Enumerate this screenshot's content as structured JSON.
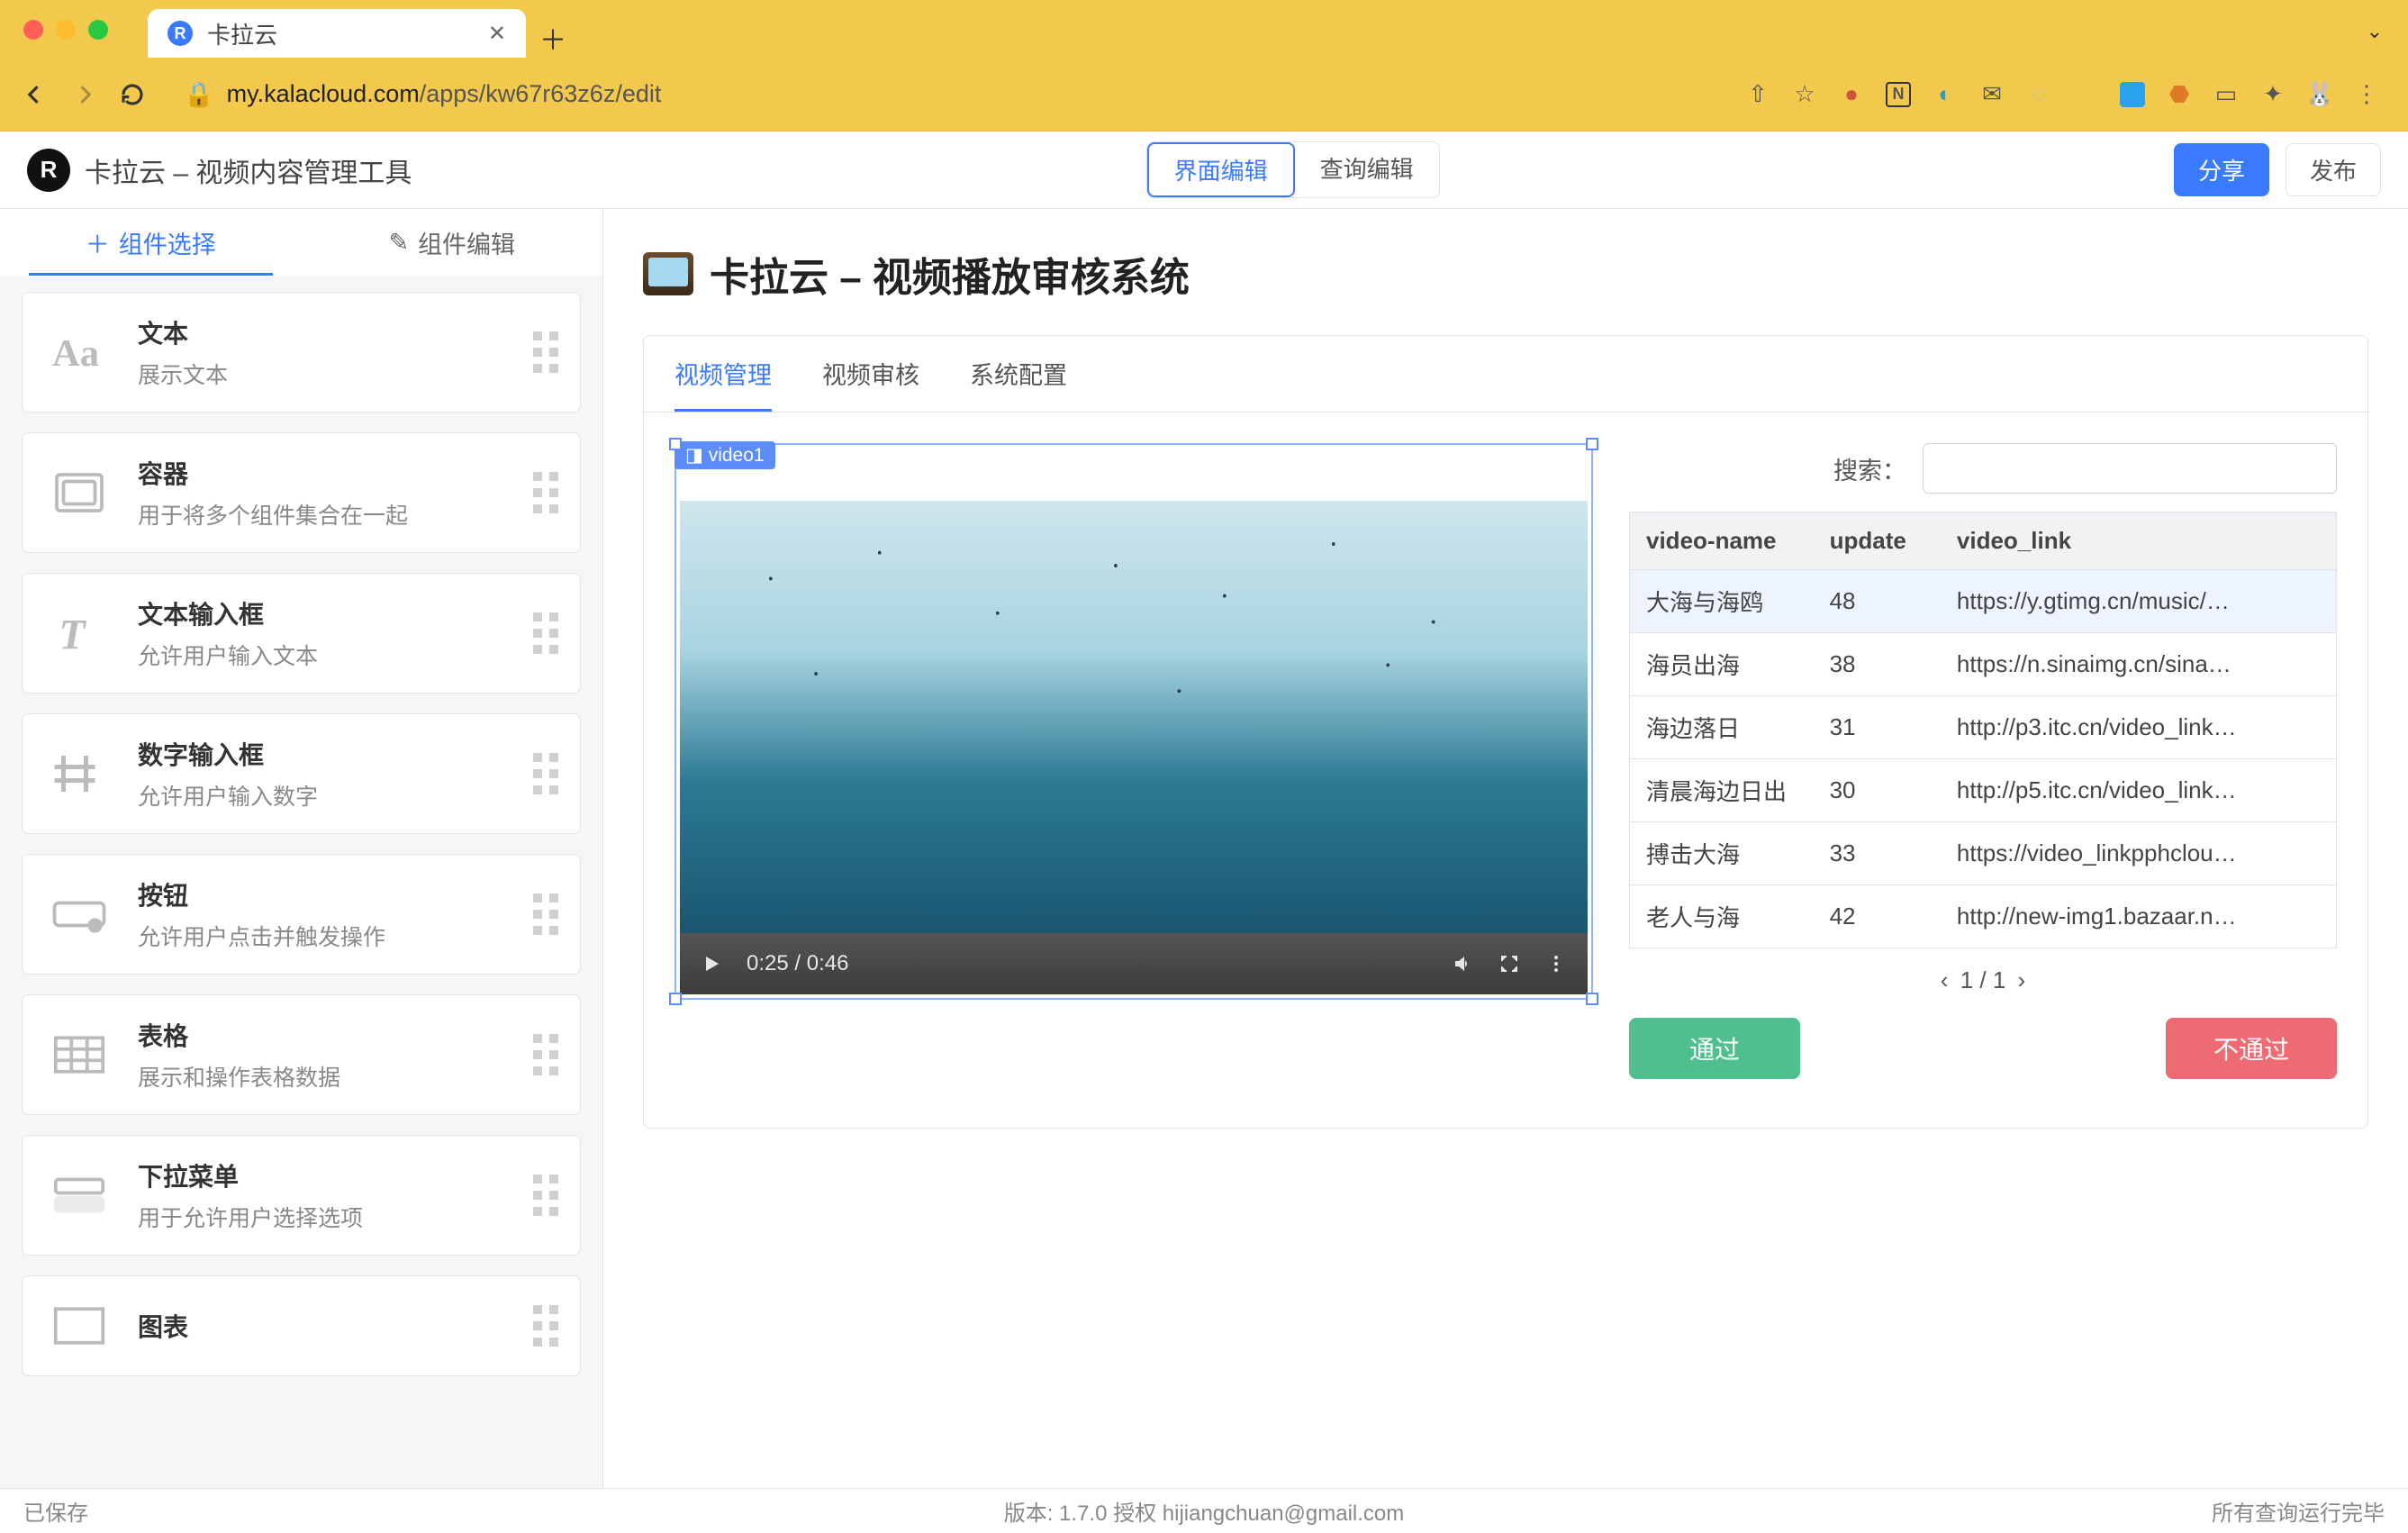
{
  "browser": {
    "tab_title": "卡拉云",
    "url_host": "my.kalacloud.com",
    "url_path": "/apps/kw67r63z6z/edit"
  },
  "header": {
    "brand": "卡拉云 – 视频内容管理工具",
    "seg_editor": "界面编辑",
    "seg_query": "查询编辑",
    "share_button": "分享",
    "publish_button": "发布"
  },
  "sidebar": {
    "tab_add": "组件选择",
    "tab_edit": "组件编辑",
    "components": [
      {
        "title": "文本",
        "desc": "展示文本",
        "icon": "text"
      },
      {
        "title": "容器",
        "desc": "用于将多个组件集合在一起",
        "icon": "container"
      },
      {
        "title": "文本输入框",
        "desc": "允许用户输入文本",
        "icon": "textinput"
      },
      {
        "title": "数字输入框",
        "desc": "允许用户输入数字",
        "icon": "number"
      },
      {
        "title": "按钮",
        "desc": "允许用户点击并触发操作",
        "icon": "button"
      },
      {
        "title": "表格",
        "desc": "展示和操作表格数据",
        "icon": "table"
      },
      {
        "title": "下拉菜单",
        "desc": "用于允许用户选择选项",
        "icon": "select"
      },
      {
        "title": "图表",
        "desc": "",
        "icon": "chart"
      }
    ]
  },
  "canvas": {
    "page_title": "卡拉云 – 视频播放审核系统",
    "panel_tabs": [
      "视频管理",
      "视频审核",
      "系统配置"
    ],
    "video_component_tag": "video1",
    "video_time": "0:25 / 0:46",
    "search_label": "搜索：",
    "table": {
      "columns": [
        "video-name",
        "update",
        "video_link"
      ],
      "rows": [
        {
          "video_name": "大海与海鸥",
          "update": "48",
          "video_link": "https://y.gtimg.cn/music/…",
          "selected": true
        },
        {
          "video_name": "海员出海",
          "update": "38",
          "video_link": "https://n.sinaimg.cn/sina…",
          "selected": false
        },
        {
          "video_name": "海边落日",
          "update": "31",
          "video_link": "http://p3.itc.cn/video_link…",
          "selected": false
        },
        {
          "video_name": "清晨海边日出",
          "update": "30",
          "video_link": "http://p5.itc.cn/video_link…",
          "selected": false
        },
        {
          "video_name": "搏击大海",
          "update": "33",
          "video_link": "https://video_linkpphclou…",
          "selected": false
        },
        {
          "video_name": "老人与海",
          "update": "42",
          "video_link": "http://new-img1.bazaar.n…",
          "selected": false
        }
      ]
    },
    "pager_text": "1 / 1",
    "btn_pass": "通过",
    "btn_reject": "不通过"
  },
  "status": {
    "left": "已保存",
    "center": "版本: 1.7.0 授权 hijiangchuan@gmail.com",
    "right": "所有查询运行完毕"
  }
}
